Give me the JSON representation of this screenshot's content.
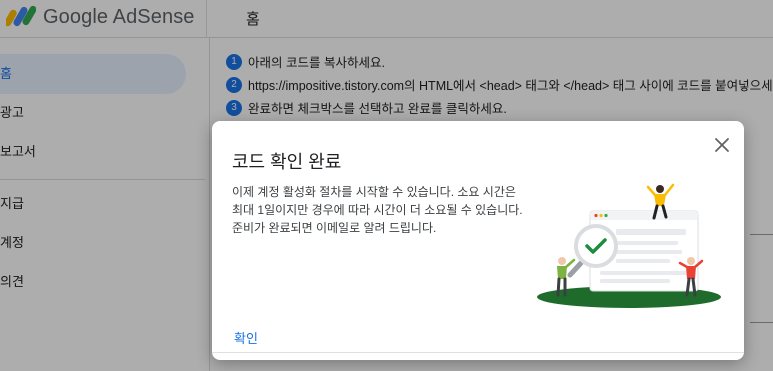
{
  "header": {
    "brand": "Google AdSense",
    "page_title": "홈"
  },
  "sidebar": {
    "items": [
      {
        "label": "홈",
        "active": true
      },
      {
        "label": "광고"
      },
      {
        "label": "보고서"
      },
      {
        "label": "지급"
      },
      {
        "label": "계정"
      },
      {
        "label": "의견"
      }
    ]
  },
  "main": {
    "steps": [
      {
        "num": "1",
        "text": "아래의 코드를 복사하세요."
      },
      {
        "num": "2",
        "text": "https://impositive.tistory.com의 HTML에서 <head> 태그와 </head> 태그 사이에 코드를 붙여넣으세요."
      },
      {
        "num": "3",
        "text": "완료하면 체크박스를 선택하고 완료를 클릭하세요."
      }
    ]
  },
  "dialog": {
    "title": "코드 확인 완료",
    "body_lines": [
      "이제 계정 활성화 절차를 시작할 수 있습니다. 소요 시간은",
      "최대 1일이지만 경우에 따라 시간이 더 소요될 수 있습니다.",
      "준비가 완료되면 이메일로 알려 드립니다."
    ],
    "ok_label": "확인"
  },
  "colors": {
    "accent": "#1a73e8",
    "scrim": "rgba(0,0,0,0.32)",
    "illustration_green": "#1e6b2c",
    "check_green": "#1e8e3e"
  }
}
